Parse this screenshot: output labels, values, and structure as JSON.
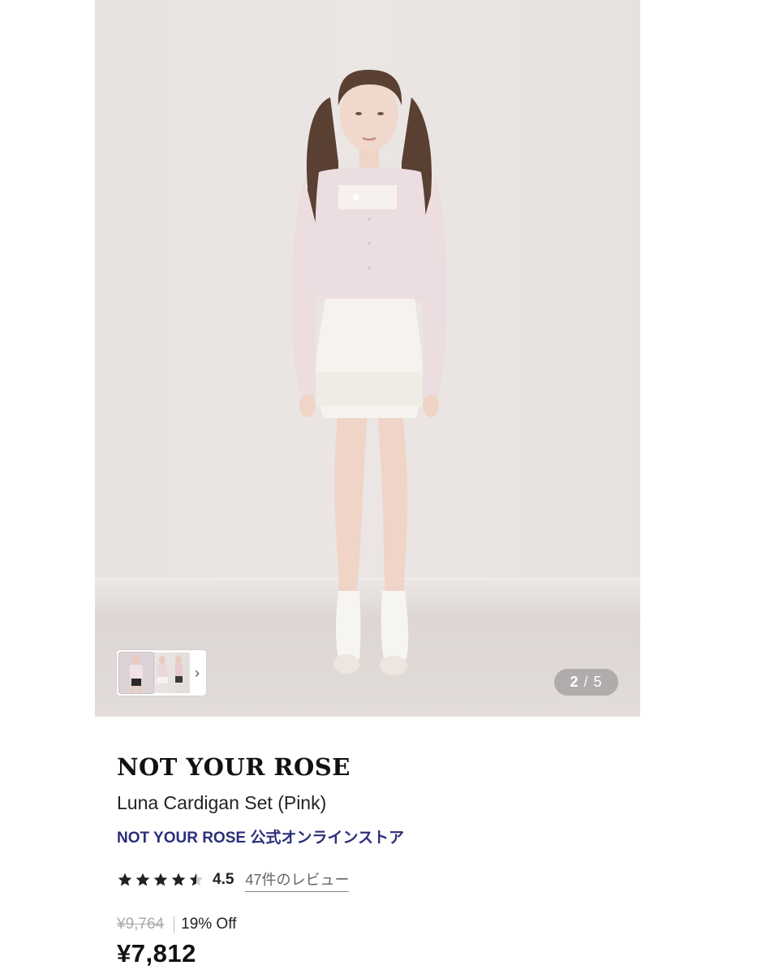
{
  "gallery": {
    "current_index": "2",
    "separator": "/",
    "total": "5",
    "next_icon": "chevron-right-icon"
  },
  "product": {
    "brand": "NOT YOUR ROSE",
    "name": "Luna Cardigan Set (Pink)",
    "store_link": "NOT YOUR ROSE 公式オンラインストア",
    "rating": {
      "value": "4.5",
      "stars": 4.5,
      "reviews_label": "47件のレビュー"
    },
    "original_price": "¥9,764",
    "discount": "19% Off",
    "price": "¥7,812"
  }
}
